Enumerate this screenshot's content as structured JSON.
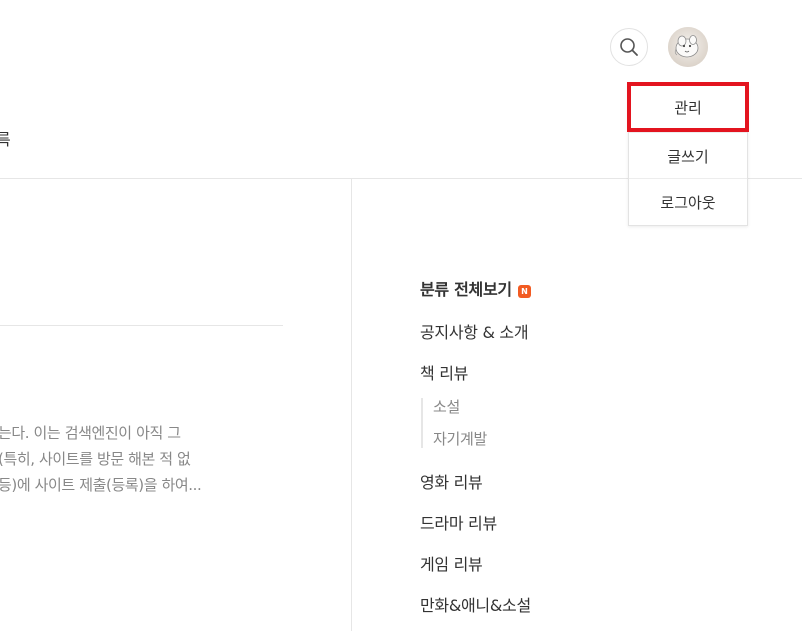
{
  "header": {
    "tab_fragment": "륵",
    "search_icon": "search-icon",
    "avatar_icon": "avatar-image"
  },
  "dropdown": {
    "items": [
      {
        "label": "관리",
        "highlighted": true
      },
      {
        "label": "글쓰기"
      },
      {
        "label": "로그아웃"
      }
    ],
    "highlight_color": "#e3141f"
  },
  "post": {
    "excerpt_lines": [
      "는다. 이는 검색엔진이 아직 그",
      "(특히, 사이트를 방문 해본 적 없",
      "등)에 사이트 제출(등록)을 하여..."
    ]
  },
  "categories": {
    "all_label": "분류 전체보기",
    "new_badge": "N",
    "new_badge_color": "#f25b22",
    "items": [
      {
        "label": "공지사항 & 소개"
      },
      {
        "label": "책 리뷰"
      },
      {
        "label": "소설"
      },
      {
        "label": "자기계발"
      },
      {
        "label": "영화 리뷰"
      },
      {
        "label": "드라마 리뷰"
      },
      {
        "label": "게임 리뷰"
      },
      {
        "label": "만화&애니&소설"
      }
    ]
  }
}
